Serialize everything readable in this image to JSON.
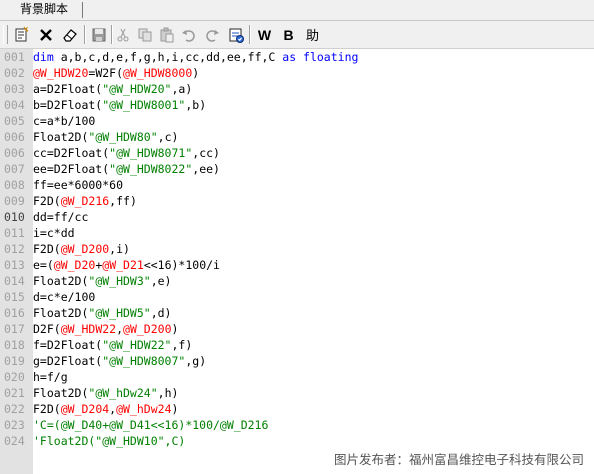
{
  "tab": {
    "label": "背景脚本"
  },
  "toolbar": {
    "buttons": [
      {
        "name": "new-icon"
      },
      {
        "name": "delete-icon"
      },
      {
        "name": "eraser-icon"
      },
      {
        "name": "save-icon"
      },
      {
        "name": "cut-icon"
      },
      {
        "name": "copy-icon"
      },
      {
        "name": "paste-icon"
      },
      {
        "name": "undo-icon"
      },
      {
        "name": "redo-icon"
      },
      {
        "name": "compile-icon"
      }
    ],
    "w_label": "W",
    "b_label": "B",
    "help_label": "助"
  },
  "colors": {
    "keyword": "#0000ff",
    "variable": "#ff0000",
    "string": "#008000",
    "comment": "#008000",
    "gutter": "#e2e2e2"
  },
  "editor": {
    "current_line": "010",
    "lines": [
      {
        "n": "001",
        "tokens": [
          [
            "kw",
            "dim"
          ],
          [
            "t",
            " a,b,c,d,e,f,g,h,i,cc,dd,ee,ff,C "
          ],
          [
            "kw",
            "as floating"
          ]
        ]
      },
      {
        "n": "002",
        "tokens": [
          [
            "var",
            "@W_HDW20"
          ],
          [
            "t",
            "=W2F("
          ],
          [
            "var",
            "@W_HDW8000"
          ],
          [
            "t",
            ")"
          ]
        ]
      },
      {
        "n": "003",
        "tokens": [
          [
            "t",
            "a=D2Float("
          ],
          [
            "str",
            "\"@W_HDW20\""
          ],
          [
            "t",
            ",a)"
          ]
        ]
      },
      {
        "n": "004",
        "tokens": [
          [
            "t",
            "b=D2Float("
          ],
          [
            "str",
            "\"@W_HDW8001\""
          ],
          [
            "t",
            ",b)"
          ]
        ]
      },
      {
        "n": "005",
        "tokens": [
          [
            "t",
            "c=a*b/100"
          ]
        ]
      },
      {
        "n": "006",
        "tokens": [
          [
            "t",
            "Float2D("
          ],
          [
            "str",
            "\"@W_HDW80\""
          ],
          [
            "t",
            ",c)"
          ]
        ]
      },
      {
        "n": "006",
        "tokens": [
          [
            "t",
            "cc=D2Float("
          ],
          [
            "str",
            "\"@W_HDW8071\""
          ],
          [
            "t",
            ",cc)"
          ]
        ]
      },
      {
        "n": "007",
        "tokens": [
          [
            "t",
            "ee=D2Float("
          ],
          [
            "str",
            "\"@W_HDW8022\""
          ],
          [
            "t",
            ",ee)"
          ]
        ]
      },
      {
        "n": "008",
        "tokens": [
          [
            "t",
            "ff=ee*6000*60"
          ]
        ]
      },
      {
        "n": "009",
        "tokens": [
          [
            "t",
            "F2D("
          ],
          [
            "var",
            "@W_D216"
          ],
          [
            "t",
            ",ff)"
          ]
        ]
      },
      {
        "n": "010",
        "tokens": [
          [
            "t",
            "dd=ff/cc"
          ]
        ]
      },
      {
        "n": "011",
        "tokens": [
          [
            "t",
            "i=c*dd"
          ]
        ]
      },
      {
        "n": "012",
        "tokens": [
          [
            "t",
            "F2D("
          ],
          [
            "var",
            "@W_D200"
          ],
          [
            "t",
            ",i)"
          ]
        ]
      },
      {
        "n": "013",
        "tokens": [
          [
            "t",
            "e=("
          ],
          [
            "var",
            "@W_D20"
          ],
          [
            "t",
            "+"
          ],
          [
            "var",
            "@W_D21"
          ],
          [
            "t",
            "<<16)*100/i"
          ]
        ]
      },
      {
        "n": "014",
        "tokens": [
          [
            "t",
            "Float2D("
          ],
          [
            "str",
            "\"@W_HDW3\""
          ],
          [
            "t",
            ",e)"
          ]
        ]
      },
      {
        "n": "015",
        "tokens": [
          [
            "t",
            "d=c*e/100"
          ]
        ]
      },
      {
        "n": "016",
        "tokens": [
          [
            "t",
            "Float2D("
          ],
          [
            "str",
            "\"@W_HDW5\""
          ],
          [
            "t",
            ",d)"
          ]
        ]
      },
      {
        "n": "017",
        "tokens": [
          [
            "t",
            "D2F("
          ],
          [
            "var",
            "@W_HDW22"
          ],
          [
            "t",
            ","
          ],
          [
            "var",
            "@W_D200"
          ],
          [
            "t",
            ")"
          ]
        ]
      },
      {
        "n": "018",
        "tokens": [
          [
            "t",
            "f=D2Float("
          ],
          [
            "str",
            "\"@W_HDW22\""
          ],
          [
            "t",
            ",f)"
          ]
        ]
      },
      {
        "n": "019",
        "tokens": [
          [
            "t",
            "g=D2Float("
          ],
          [
            "str",
            "\"@W_HDW8007\""
          ],
          [
            "t",
            ",g)"
          ]
        ]
      },
      {
        "n": "020",
        "tokens": [
          [
            "t",
            "h=f/g"
          ]
        ]
      },
      {
        "n": "021",
        "tokens": [
          [
            "t",
            "Float2D("
          ],
          [
            "str",
            "\"@W_hDw24\""
          ],
          [
            "t",
            ",h)"
          ]
        ]
      },
      {
        "n": "022",
        "tokens": [
          [
            "t",
            "F2D("
          ],
          [
            "var",
            "@W_D204"
          ],
          [
            "t",
            ","
          ],
          [
            "var",
            "@W_hDw24"
          ],
          [
            "t",
            ")"
          ]
        ]
      },
      {
        "n": "023",
        "tokens": [
          [
            "cmt",
            "'C=(@W_D40+@W_D41<<16)*100/@W_D216"
          ]
        ]
      },
      {
        "n": "024",
        "tokens": [
          [
            "cmt",
            "'Float2D(\"@W_HDW10\",C)"
          ]
        ]
      }
    ]
  },
  "watermark": "图片发布者：福州富昌维控电子科技有限公司"
}
